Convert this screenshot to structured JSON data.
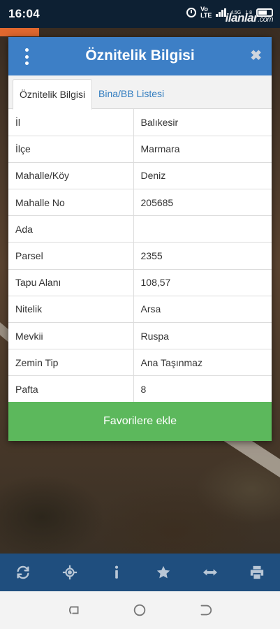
{
  "status_bar": {
    "time": "16:04",
    "volte": "Vo LTE",
    "network": "4.5G",
    "speed": "1.8",
    "watermark_main": "ilanlar",
    "watermark_suffix": ".com"
  },
  "dialog": {
    "title": "Öznitelik Bilgisi",
    "close_symbol": "✖",
    "tabs": [
      {
        "label": "Öznitelik Bilgisi",
        "active": true
      },
      {
        "label": "Bina/BB Listesi",
        "active": false
      }
    ],
    "rows": [
      {
        "label": "İl",
        "value": "Balıkesir"
      },
      {
        "label": "İlçe",
        "value": "Marmara"
      },
      {
        "label": "Mahalle/Köy",
        "value": "Deniz"
      },
      {
        "label": "Mahalle No",
        "value": "205685"
      },
      {
        "label": "Ada",
        "value": ""
      },
      {
        "label": "Parsel",
        "value": "2355"
      },
      {
        "label": "Tapu Alanı",
        "value": "108,57"
      },
      {
        "label": "Nitelik",
        "value": "Arsa"
      },
      {
        "label": "Mevkii",
        "value": "Ruspa"
      },
      {
        "label": "Zemin Tip",
        "value": "Ana Taşınmaz"
      },
      {
        "label": "Pafta",
        "value": "8"
      }
    ],
    "favorite_button": "Favorilere ekle"
  },
  "toolbar": {
    "items": [
      "refresh-icon",
      "locate-icon",
      "info-icon",
      "star-icon",
      "measure-icon",
      "print-icon"
    ]
  },
  "colors": {
    "header_blue": "#3d7fc6",
    "tab_link_blue": "#2f7bbf",
    "button_green": "#5cb85c",
    "toolbar_blue": "#1f4e7e"
  }
}
